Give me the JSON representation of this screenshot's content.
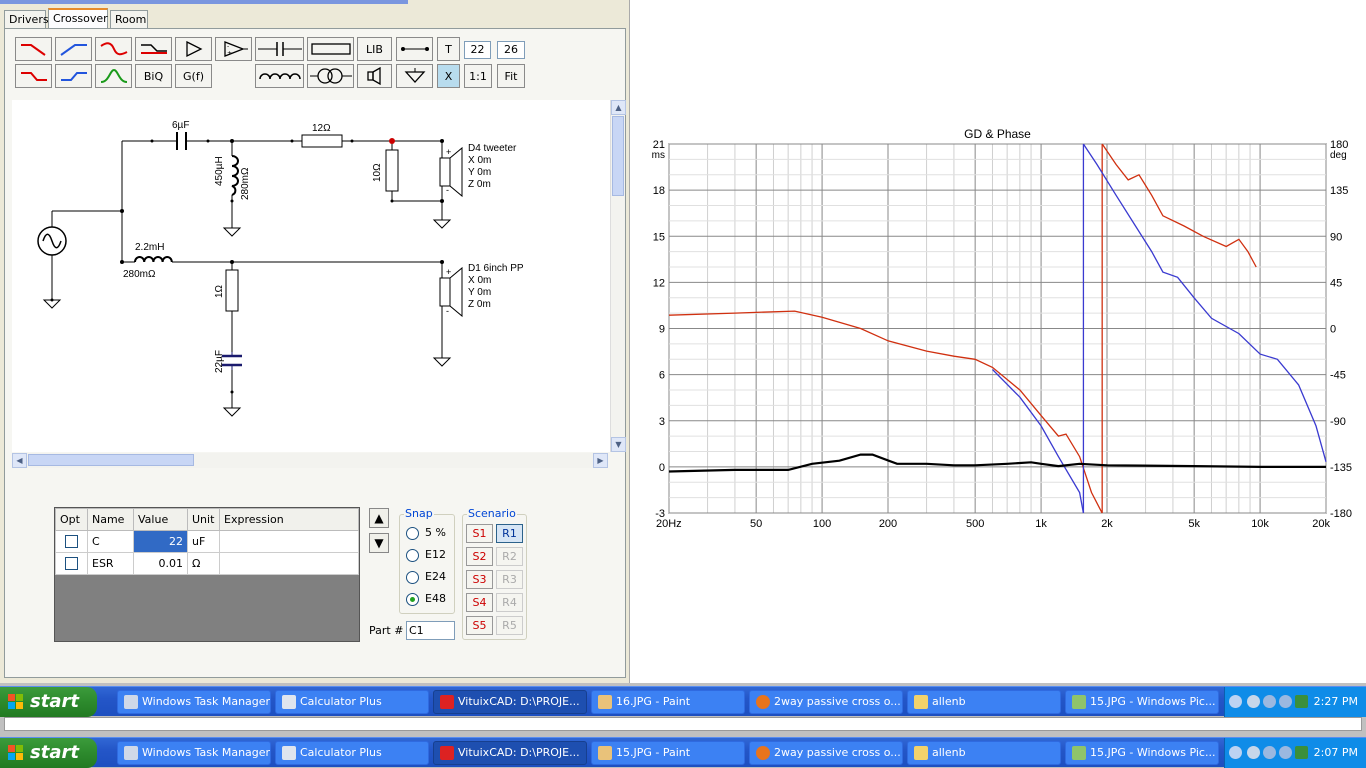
{
  "tabs": [
    "Drivers",
    "Crossover",
    "Room"
  ],
  "toolbar": {
    "lib_label": "LIB",
    "t_label": "T",
    "num1": "22",
    "num2": "26",
    "biq_label": "BiQ",
    "gf_label": "G(f)",
    "x_label": "X",
    "ratio_label": "1:1",
    "fit_label": "Fit"
  },
  "schematic": {
    "labels": {
      "c6": "6µF",
      "r12": "12Ω",
      "l450": "450µH",
      "r280a": "280mΩ",
      "r10": "10Ω",
      "d4_name": "D4 tweeter",
      "d4_x": "X 0m",
      "d4_y": "Y 0m",
      "d4_z": "Z 0m",
      "l22": "2.2mH",
      "r280b": "280mΩ",
      "r1": "1Ω",
      "c22": "22µF",
      "d1_name": "D1 6inch PP",
      "d1_x": "X 0m",
      "d1_y": "Y 0m",
      "d1_z": "Z 0m"
    }
  },
  "parts_table": {
    "headers": [
      "Opt",
      "Name",
      "Value",
      "Unit",
      "Expression"
    ],
    "rows": [
      {
        "name": "C",
        "value": "22",
        "unit": "uF",
        "expression": ""
      },
      {
        "name": "ESR",
        "value": "0.01",
        "unit": "Ω",
        "expression": ""
      }
    ]
  },
  "snap": {
    "title": "Snap",
    "options": [
      "5 %",
      "E12",
      "E24",
      "E48"
    ],
    "selected": "E48"
  },
  "scenario": {
    "title": "Scenario",
    "s": [
      "S1",
      "S2",
      "S3",
      "S4",
      "S5"
    ],
    "r": [
      "R1",
      "R2",
      "R3",
      "R4",
      "R5"
    ],
    "active_r": "R1"
  },
  "part_number": {
    "label": "Part #",
    "value": "C1"
  },
  "chart_data": {
    "type": "line",
    "title": "GD & Phase",
    "x_scale": "log",
    "xlim": [
      20,
      20000
    ],
    "x_ticks": [
      "20Hz",
      "50",
      "100",
      "200",
      "500",
      "1k",
      "2k",
      "5k",
      "10k",
      "20k"
    ],
    "y_left_unit": "ms",
    "y_left_ticks": [
      "21",
      "18",
      "15",
      "12",
      "9",
      "6",
      "3",
      "0",
      "-3"
    ],
    "ylim_left": [
      -3,
      21
    ],
    "y_right_unit": "deg",
    "y_right_ticks": [
      "180",
      "135",
      "90",
      "45",
      "0",
      "-45",
      "-90",
      "-135",
      "-180"
    ],
    "ylim_right": [
      -180,
      180
    ],
    "grid": true,
    "series": [
      {
        "color": "#d03010",
        "axis": "right",
        "points": [
          [
            20,
            13
          ],
          [
            40,
            15
          ],
          [
            75,
            17
          ],
          [
            100,
            11
          ],
          [
            150,
            0
          ],
          [
            200,
            -12
          ],
          [
            300,
            -22
          ],
          [
            400,
            -27
          ],
          [
            500,
            -30
          ],
          [
            600,
            -38
          ],
          [
            800,
            -60
          ],
          [
            1000,
            -85
          ],
          [
            1200,
            -105
          ],
          [
            1300,
            -103
          ],
          [
            1500,
            -125
          ],
          [
            1700,
            -160
          ],
          [
            1900,
            -180
          ],
          [
            1901,
            180
          ],
          [
            2200,
            160
          ],
          [
            2500,
            145
          ],
          [
            2800,
            150
          ],
          [
            3200,
            130
          ],
          [
            3600,
            110
          ],
          [
            4500,
            100
          ],
          [
            5500,
            90
          ],
          [
            7000,
            80
          ],
          [
            8000,
            87
          ],
          [
            8800,
            75
          ],
          [
            9600,
            60
          ]
        ]
      },
      {
        "color": "#3a3ad0",
        "axis": "right",
        "points": [
          [
            600,
            -40
          ],
          [
            800,
            -67
          ],
          [
            1000,
            -95
          ],
          [
            1200,
            -125
          ],
          [
            1500,
            -160
          ],
          [
            1560,
            -180
          ],
          [
            1561,
            180
          ],
          [
            1800,
            160
          ],
          [
            2200,
            130
          ],
          [
            2700,
            100
          ],
          [
            3200,
            75
          ],
          [
            3600,
            55
          ],
          [
            4200,
            50
          ],
          [
            5000,
            30
          ],
          [
            6000,
            10
          ],
          [
            8000,
            -5
          ],
          [
            10000,
            -25
          ],
          [
            12000,
            -30
          ],
          [
            15000,
            -55
          ],
          [
            18000,
            -95
          ],
          [
            20000,
            -130
          ]
        ]
      },
      {
        "color": "#000000",
        "axis": "left",
        "points": [
          [
            20,
            -0.3
          ],
          [
            40,
            -0.2
          ],
          [
            70,
            -0.2
          ],
          [
            90,
            0.2
          ],
          [
            120,
            0.4
          ],
          [
            150,
            0.8
          ],
          [
            170,
            0.8
          ],
          [
            220,
            0.2
          ],
          [
            300,
            0.2
          ],
          [
            400,
            0.1
          ],
          [
            500,
            0.1
          ],
          [
            700,
            0.2
          ],
          [
            900,
            0.3
          ],
          [
            1000,
            0.2
          ],
          [
            1200,
            0.05
          ],
          [
            1500,
            0.2
          ],
          [
            2000,
            0.1
          ],
          [
            5000,
            0.05
          ],
          [
            10000,
            0
          ],
          [
            20000,
            0
          ]
        ]
      }
    ]
  },
  "taskbar_top": {
    "start": "start",
    "items": [
      "Windows Task Manager",
      "Calculator Plus",
      "VituixCAD: D:\\PROJE...",
      "16.JPG - Paint",
      "2way passive cross o...",
      "allenb",
      "15.JPG - Windows Pic..."
    ],
    "clock": "2:27 PM"
  },
  "taskbar_bottom": {
    "start": "start",
    "items": [
      "Windows Task Manager",
      "Calculator Plus",
      "VituixCAD: D:\\PROJE...",
      "15.JPG - Paint",
      "2way passive cross o...",
      "allenb",
      "15.JPG - Windows Pic..."
    ],
    "clock": "2:07 PM"
  },
  "colors": {
    "accent": "#316ac5",
    "taskbar": "#245edb",
    "start": "#2d8a2d"
  }
}
